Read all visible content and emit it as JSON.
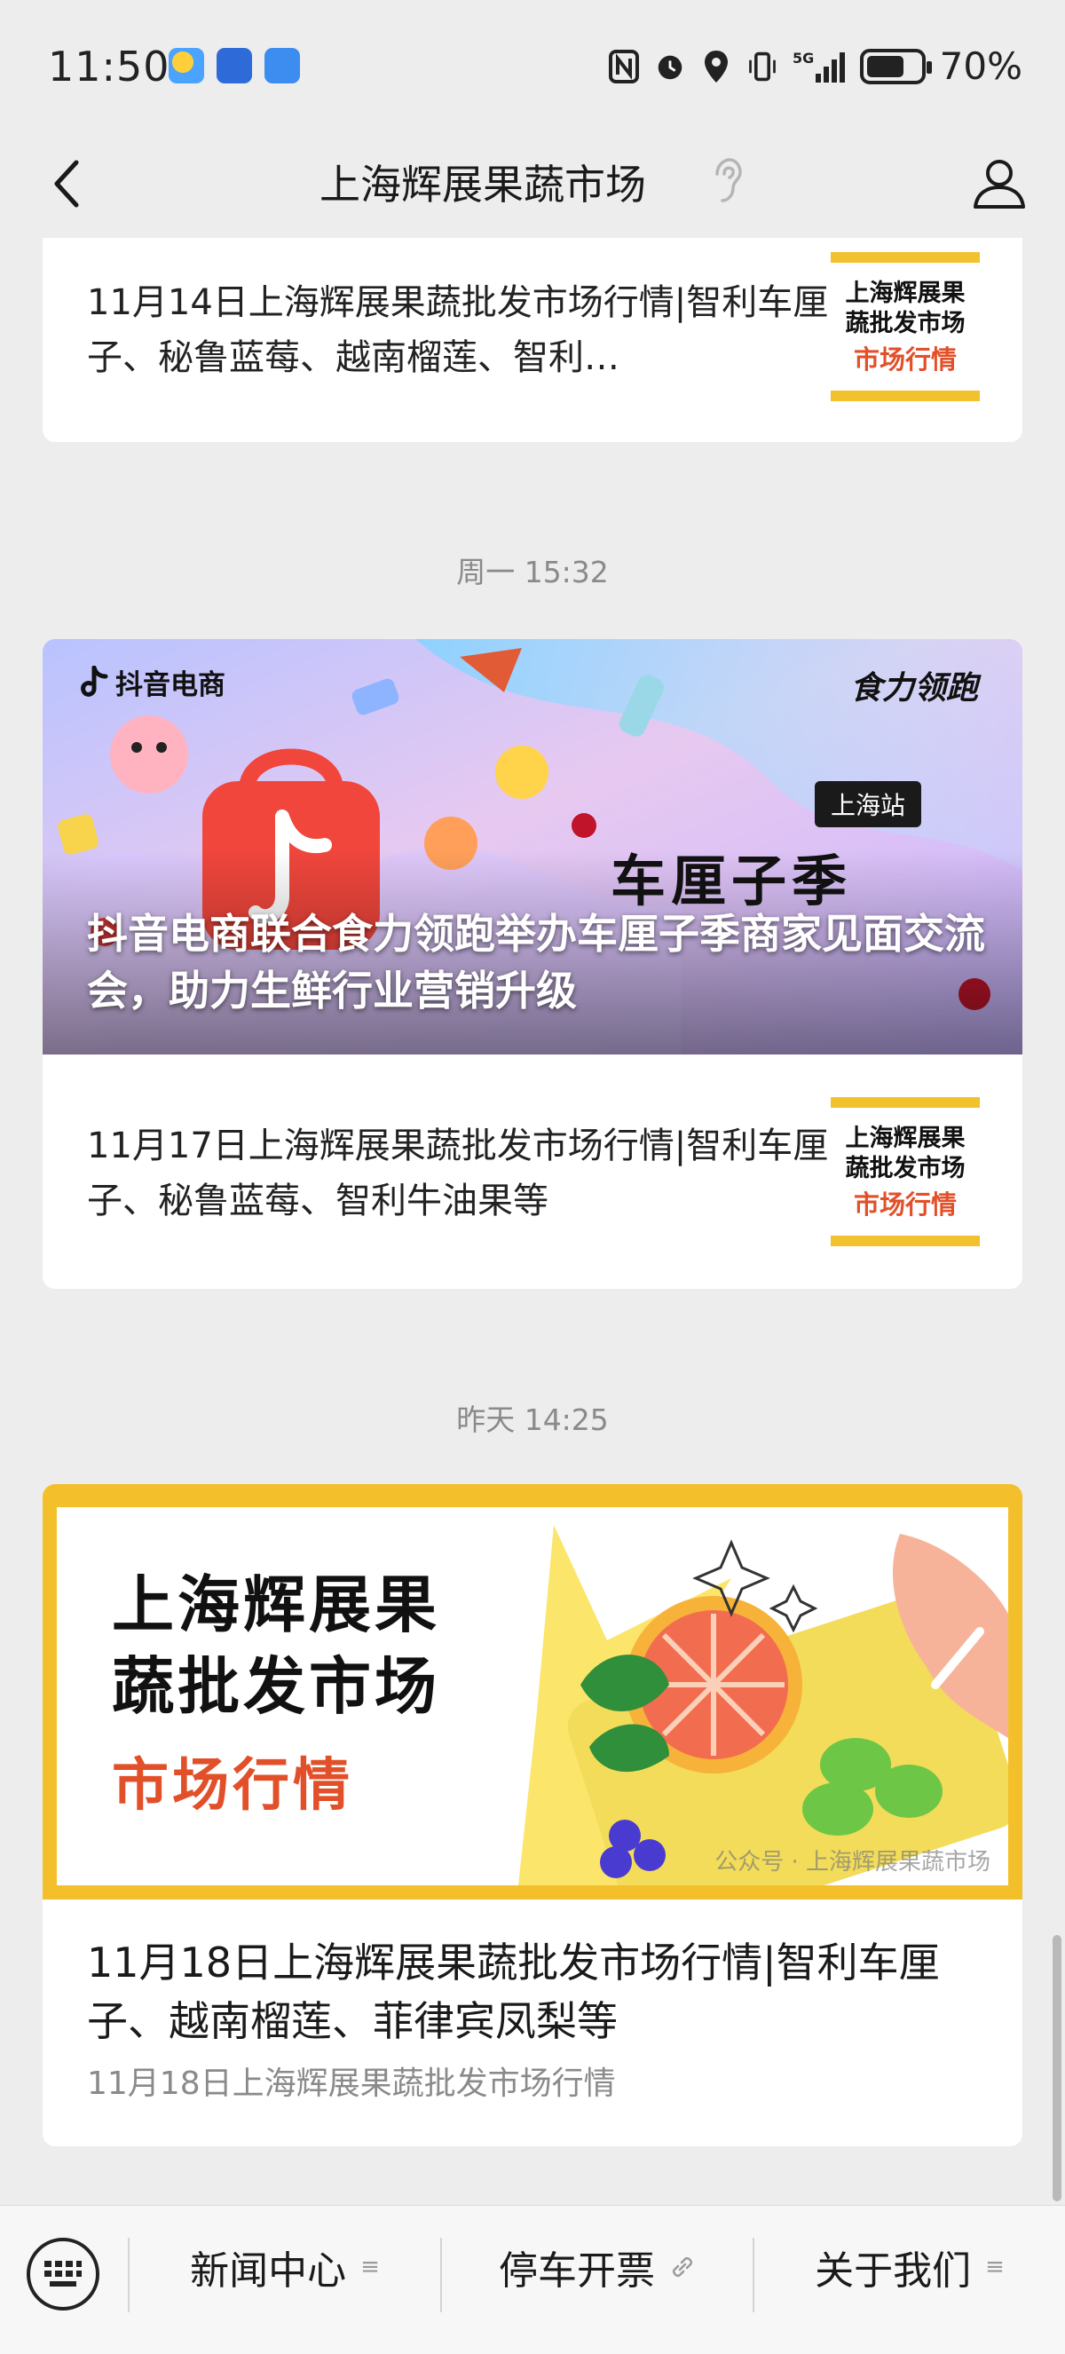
{
  "status_bar": {
    "time": "11:50",
    "network": "5G",
    "battery_percent": "70%",
    "battery_level": 0.7
  },
  "header": {
    "title": "上海辉展果蔬市场"
  },
  "feed": {
    "item1": {
      "text": "11月14日上海辉展果蔬批发市场行情|智利车厘子、秘鲁蓝莓、越南榴莲、智利…",
      "thumb": {
        "line1": "上海辉展果",
        "line2": "蔬批发市场",
        "line3": "市场行情"
      }
    },
    "timestamp1": "周一 15:32",
    "cover1": {
      "logo": "抖音电商",
      "brand": "食力领跑",
      "badge": "上海站",
      "headline": "车厘子季",
      "title": "抖音电商联合食力领跑举办车厘子季商家见面交流会，助力生鲜行业营销升级"
    },
    "item2": {
      "text": "11月17日上海辉展果蔬批发市场行情|智利车厘子、秘鲁蓝莓、智利牛油果等",
      "thumb": {
        "line1": "上海辉展果",
        "line2": "蔬批发市场",
        "line3": "市场行情"
      }
    },
    "timestamp2": "昨天 14:25",
    "cover2": {
      "line1": "上海辉展果",
      "line2": "蔬批发市场",
      "line3": "市场行情",
      "watermark": "公众号 · 上海辉展果蔬市场",
      "title": "11月18日上海辉展果蔬批发市场行情|智利车厘子、越南榴莲、菲律宾凤梨等",
      "subtitle": "11月18日上海辉展果蔬批发市场行情"
    }
  },
  "bottom_menu": {
    "items": [
      {
        "label": "新闻中心",
        "icon": "menu-lines-icon"
      },
      {
        "label": "停车开票",
        "icon": "link-icon"
      },
      {
        "label": "关于我们",
        "icon": "menu-lines-icon"
      }
    ]
  },
  "colors": {
    "background": "#ededed",
    "card": "#ffffff",
    "accent_yellow": "#f3c02b",
    "accent_orange": "#e2502a",
    "muted_text": "#8a8a8a"
  }
}
